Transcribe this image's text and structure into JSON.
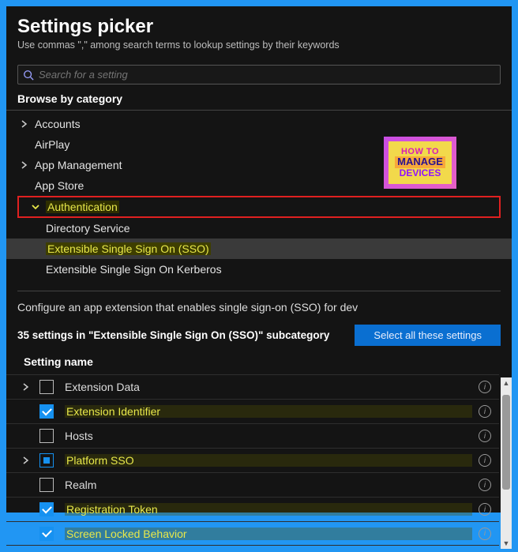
{
  "header": {
    "title": "Settings picker",
    "subtitle": "Use commas \",\" among search terms to lookup settings by their keywords"
  },
  "search": {
    "placeholder": "Search for a setting"
  },
  "browseLabel": "Browse by category",
  "categories": {
    "accounts": "Accounts",
    "airplay": "AirPlay",
    "appManagement": "App Management",
    "appStore": "App Store",
    "authentication": "Authentication",
    "directoryService": "Directory Service",
    "extSSO": "Extensible Single Sign On (SSO)",
    "extSSOKerberos": "Extensible Single Sign On Kerberos"
  },
  "description": "Configure an app extension that enables single sign-on (SSO) for dev",
  "countText": "35 settings in \"Extensible Single Sign On (SSO)\" subcategory",
  "selectAllLabel": "Select all these settings",
  "columnHeader": "Setting name",
  "settings": [
    {
      "label": "Extension Data",
      "checked": false,
      "accent": false,
      "expandable": true,
      "indeterminate": false
    },
    {
      "label": "Extension Identifier",
      "checked": true,
      "accent": true,
      "expandable": false,
      "indeterminate": false
    },
    {
      "label": "Hosts",
      "checked": false,
      "accent": false,
      "expandable": false,
      "indeterminate": false
    },
    {
      "label": "Platform SSO",
      "checked": false,
      "accent": true,
      "expandable": true,
      "indeterminate": true
    },
    {
      "label": "Realm",
      "checked": false,
      "accent": false,
      "expandable": false,
      "indeterminate": false
    },
    {
      "label": "Registration Token",
      "checked": true,
      "accent": true,
      "expandable": false,
      "indeterminate": false
    },
    {
      "label": "Screen Locked Behavior",
      "checked": true,
      "accent": true,
      "expandable": false,
      "indeterminate": false
    }
  ],
  "badge": {
    "l1": "HOW TO",
    "l2": "MANAGE",
    "l3": "DEVICES"
  }
}
